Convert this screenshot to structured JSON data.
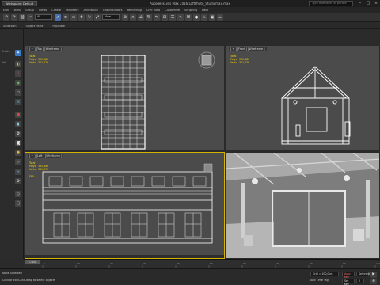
{
  "titlebar": {
    "workspace": "Workspace: Default",
    "title": "Autodesk 3ds Max 2016     LoftPhoto_Studiomax.max",
    "search_placeholder": "Type a keyword or phrase"
  },
  "menubar": {
    "items": [
      "Edit",
      "Tools",
      "Group",
      "Views",
      "Create",
      "Modifiers",
      "Animation",
      "Graph Editors",
      "Rendering",
      "Civil View",
      "Customize",
      "Scripting",
      "Help"
    ]
  },
  "toolbar": {
    "selection_filter": "All",
    "view_dropdown": "View"
  },
  "ribbon": {
    "tabs": [
      "Selection",
      "Object Paint",
      "Populate"
    ]
  },
  "left_panel": {
    "labels": [
      "Create",
      "Sel"
    ]
  },
  "viewports": {
    "top": {
      "label": "[ + ] [Top ] [Wireframe ]",
      "stats": {
        "title": "Total",
        "polys_label": "Polys:",
        "polys_value": "335,886",
        "verts_label": "Verts:",
        "verts_value": "341,876"
      }
    },
    "front": {
      "label": "[ + ] [Front ] [Wireframe ]",
      "stats": {
        "title": "Total",
        "polys_label": "Polys:",
        "polys_value": "335,886",
        "verts_label": "Verts:",
        "verts_value": "341,876"
      }
    },
    "left": {
      "label": "[ + ] [Left ] [Wireframe ]",
      "stats": {
        "title": "Total",
        "polys_label": "Polys:",
        "polys_value": "335,886",
        "verts_label": "Verts:",
        "verts_value": "341,876",
        "fps_label": "FPS:"
      }
    },
    "perspective": {
      "label": "[ + ] [Perspective ] [Realistic ]"
    }
  },
  "timeline": {
    "slider_label": "0 / 100",
    "ticks": [
      "0",
      "10",
      "20",
      "30",
      "40",
      "50",
      "60",
      "70",
      "80",
      "90",
      "100"
    ]
  },
  "statusbar": {
    "selection": "None Selected",
    "prompt": "Click or click-and-drag to select objects",
    "grid": "Grid = 100,0cm",
    "add_time_tag": "Add Time Tag",
    "set_key": "Set Key",
    "auto_key": "Auto Key",
    "selected": "Selected",
    "frame": "0"
  },
  "colors": {
    "viewport_bg": "#4b4b4b",
    "active_border": "#d6b200",
    "wire": "#ffffff",
    "stats_text": "#f5d300"
  }
}
